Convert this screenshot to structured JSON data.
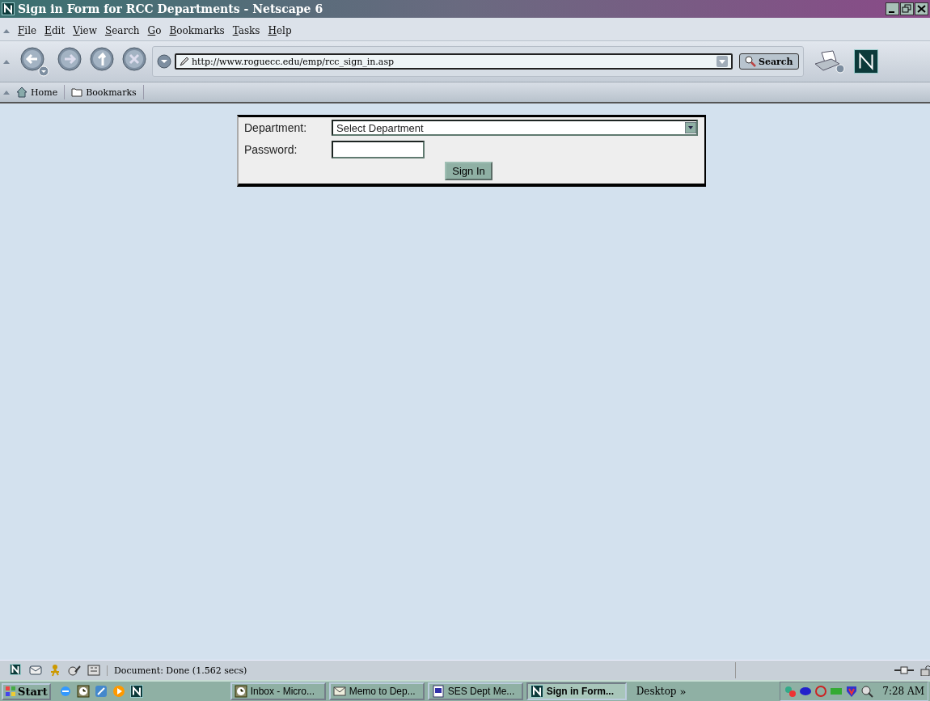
{
  "window": {
    "title": "Sign in Form for RCC Departments - Netscape 6"
  },
  "menu": [
    "File",
    "Edit",
    "View",
    "Search",
    "Go",
    "Bookmarks",
    "Tasks",
    "Help"
  ],
  "navigation": {
    "url": "http://www.roguecc.edu/emp/rcc_sign_in.asp",
    "search_button": "Search"
  },
  "personal_bar": [
    {
      "kind": "home",
      "label": "Home"
    },
    {
      "kind": "folder",
      "label": "Bookmarks"
    }
  ],
  "form": {
    "department_label": "Department:",
    "department_value": "Select Department",
    "password_label": "Password:",
    "submit": "Sign In"
  },
  "status_bar": {
    "text": "Document: Done (1.562 secs)"
  },
  "taskbar": {
    "start": "Start",
    "tasks": [
      {
        "kind": "calendar",
        "label": "Inbox - Micro...",
        "selected": false
      },
      {
        "kind": "mail",
        "label": "Memo to Dep...",
        "selected": false
      },
      {
        "kind": "document",
        "label": "SES Dept Me...",
        "selected": false
      },
      {
        "kind": "browser",
        "label": "Sign in Form...",
        "selected": true
      }
    ],
    "desktop": "Desktop",
    "chevron": "»",
    "clock": "7:28 AM"
  }
}
